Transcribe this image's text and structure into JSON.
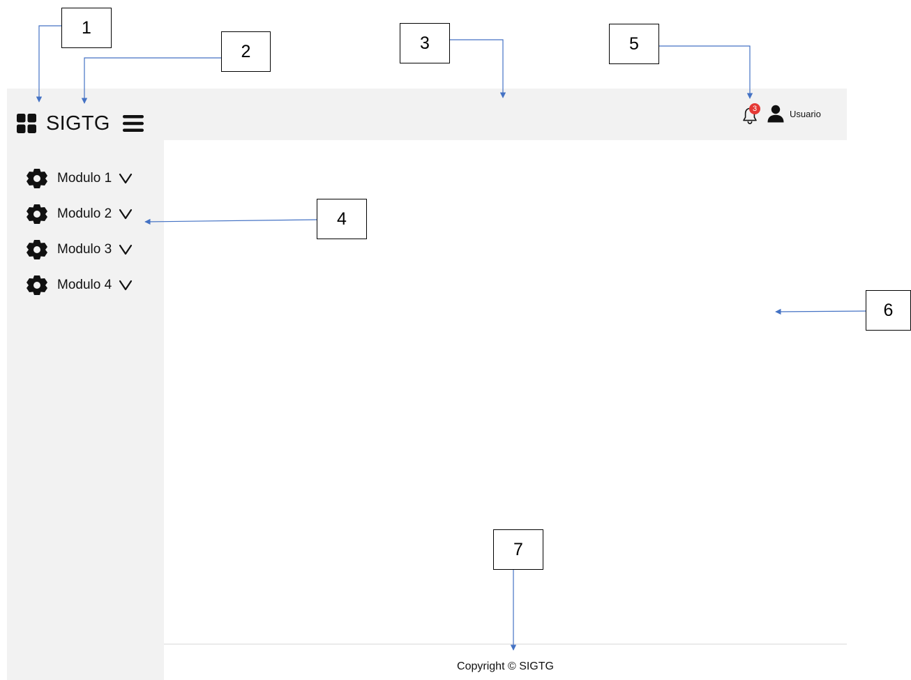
{
  "app": {
    "title": "SIGTG",
    "user_label": "Usuario",
    "notification_count": "3",
    "icons": {
      "logo": "grid-icon",
      "menu": "hamburger-menu-icon",
      "notifications": "bell-icon",
      "user": "user-icon",
      "module": "gear-icon",
      "expand": "chevron-down-icon"
    }
  },
  "sidebar": {
    "items": [
      {
        "label": "Modulo 1"
      },
      {
        "label": "Modulo 2"
      },
      {
        "label": "Modulo 3"
      },
      {
        "label": "Modulo 4"
      }
    ]
  },
  "footer": {
    "text": "Copyright © SIGTG"
  },
  "callouts": [
    {
      "label": "1"
    },
    {
      "label": "2"
    },
    {
      "label": "3"
    },
    {
      "label": "4"
    },
    {
      "label": "5"
    },
    {
      "label": "6"
    },
    {
      "label": "7"
    }
  ],
  "colors": {
    "panel_background": "#f2f2f2",
    "arrow": "#4472c4",
    "badge": "#e53935",
    "page_background": "#ffffff"
  }
}
